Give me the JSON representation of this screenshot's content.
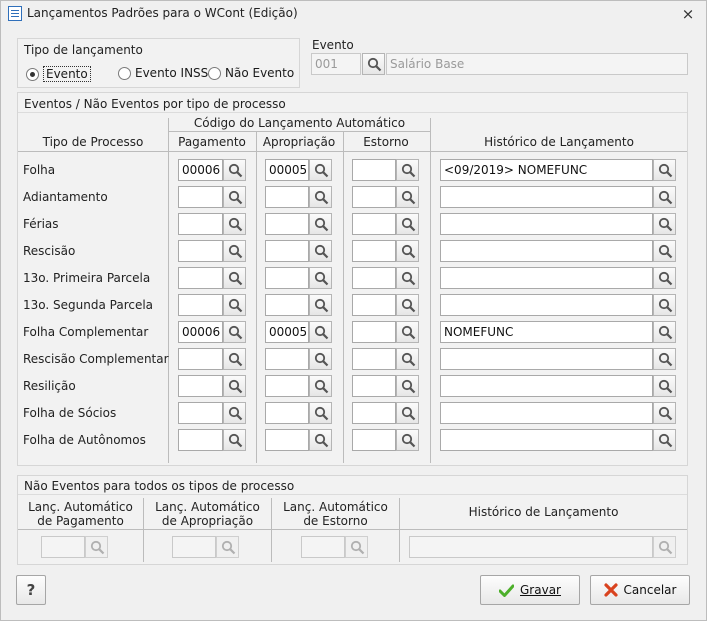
{
  "window": {
    "title": "Lançamentos Padrões para o WCont (Edição)",
    "close_glyph": "⨯"
  },
  "tipo_lancamento": {
    "label": "Tipo de lançamento",
    "options": [
      {
        "label": "Evento",
        "selected": true
      },
      {
        "label": "Evento INSS",
        "selected": false
      },
      {
        "label": "Não Evento",
        "selected": false
      }
    ]
  },
  "evento": {
    "label": "Evento",
    "code": "001",
    "description": "Salário Base"
  },
  "eventos_group": {
    "label": "Eventos / Não Eventos por tipo de processo",
    "super_header": "Código do Lançamento Automático",
    "headers": {
      "tipo_processo": "Tipo de Processo",
      "pagamento": "Pagamento",
      "apropriacao": "Apropriação",
      "estorno": "Estorno",
      "historico": "Histórico de Lançamento"
    },
    "rows": [
      {
        "label": "Folha",
        "pagamento": "00006",
        "apropriacao": "00005",
        "estorno": "",
        "historico": "<09/2019> NOMEFUNC"
      },
      {
        "label": "Adiantamento",
        "pagamento": "",
        "apropriacao": "",
        "estorno": "",
        "historico": ""
      },
      {
        "label": "Férias",
        "pagamento": "",
        "apropriacao": "",
        "estorno": "",
        "historico": ""
      },
      {
        "label": "Rescisão",
        "pagamento": "",
        "apropriacao": "",
        "estorno": "",
        "historico": ""
      },
      {
        "label": "13o. Primeira Parcela",
        "pagamento": "",
        "apropriacao": "",
        "estorno": "",
        "historico": ""
      },
      {
        "label": "13o. Segunda Parcela",
        "pagamento": "",
        "apropriacao": "",
        "estorno": "",
        "historico": ""
      },
      {
        "label": "Folha Complementar",
        "pagamento": "00006",
        "apropriacao": "00005",
        "estorno": "",
        "historico": "NOMEFUNC"
      },
      {
        "label": "Rescisão Complementar",
        "pagamento": "",
        "apropriacao": "",
        "estorno": "",
        "historico": ""
      },
      {
        "label": "Resilição",
        "pagamento": "",
        "apropriacao": "",
        "estorno": "",
        "historico": ""
      },
      {
        "label": "Folha de Sócios",
        "pagamento": "",
        "apropriacao": "",
        "estorno": "",
        "historico": ""
      },
      {
        "label": "Folha de Autônomos",
        "pagamento": "",
        "apropriacao": "",
        "estorno": "",
        "historico": ""
      }
    ]
  },
  "nao_eventos_group": {
    "label": "Não Eventos para todos os tipos de processo",
    "headers": {
      "pagamento_l1": "Lanç. Automático",
      "pagamento_l2": "de Pagamento",
      "apropriacao_l1": "Lanç. Automático",
      "apropriacao_l2": "de Apropriação",
      "estorno_l1": "Lanç. Automático",
      "estorno_l2": "de Estorno",
      "historico": "Histórico de Lançamento"
    },
    "values": {
      "pagamento": "",
      "apropriacao": "",
      "estorno": "",
      "historico": ""
    }
  },
  "footer": {
    "help_label": "?",
    "save_label": "Gravar",
    "cancel_label": "Cancelar"
  },
  "icons": [
    "search-icon",
    "check-icon",
    "cancel-x-icon",
    "help-icon",
    "close-icon",
    "form-icon"
  ],
  "colors": {
    "save_check": "#4caf2a",
    "cancel_x": "#d9431f",
    "window_bg": "#f0f0f0"
  }
}
